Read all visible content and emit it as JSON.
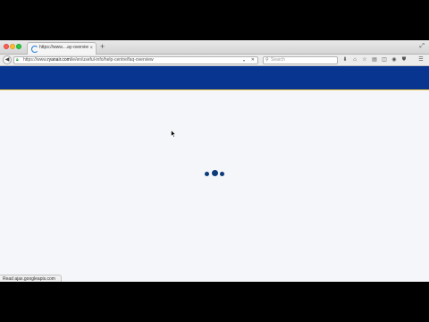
{
  "browser": {
    "tab": {
      "title": "https://www....ay-overview",
      "close_glyph": "×",
      "loading": true
    },
    "new_tab_glyph": "+",
    "address": {
      "prefix": "https://www.",
      "host": "ryanair.com",
      "path": "/ie/en/useful-info/help-centre/faq-overview",
      "dropdown_glyph": "▾",
      "stop_glyph": "✕"
    },
    "search": {
      "placeholder": "Search"
    },
    "status_text": "Read ajax.googleapis.com"
  },
  "page": {
    "header_color": "#073590",
    "accent_color": "#f2c94c",
    "background_color": "#f4f6fa",
    "loader_color": "#0d3a78"
  }
}
